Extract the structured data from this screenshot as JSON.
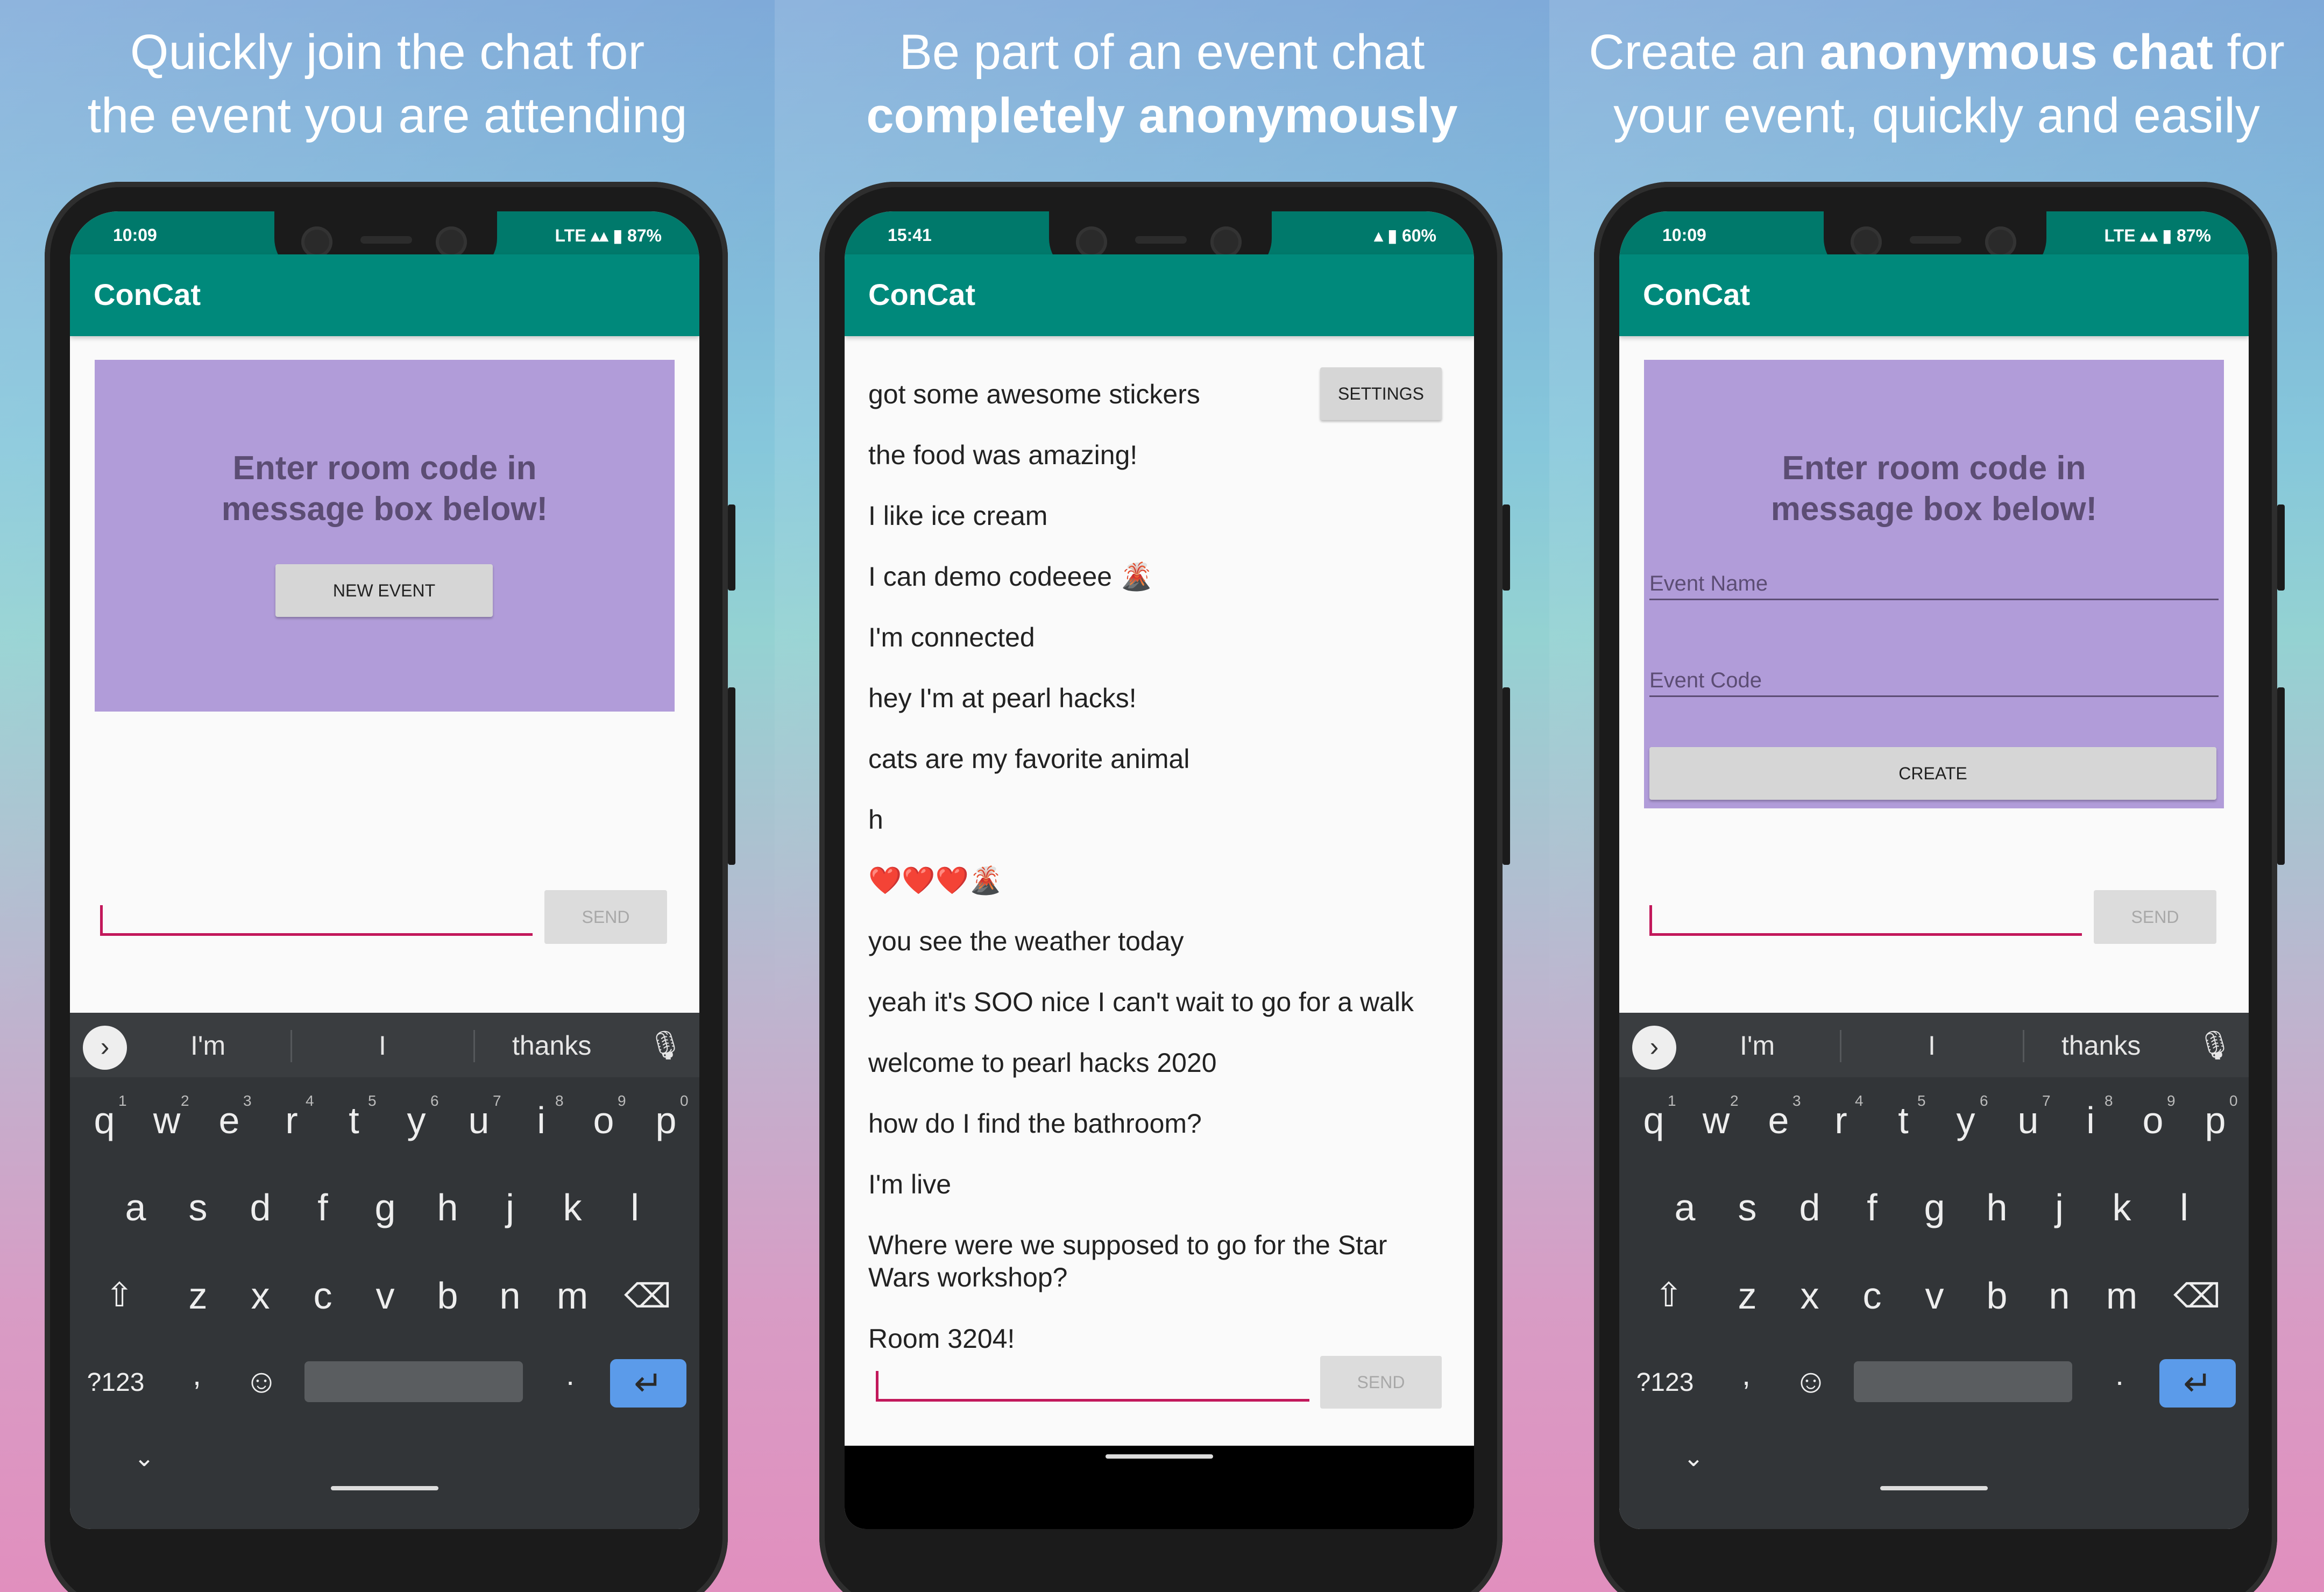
{
  "colors": {
    "appbar": "#00897b",
    "statusbar": "#00796b",
    "purple": "#b19cd9",
    "accent": "#c2185b",
    "enter": "#5b9bea"
  },
  "panel1": {
    "headline_line1": "Quickly join the chat for",
    "headline_line2": "the event you are attending",
    "status_time": "10:09",
    "status_right": "LTE ▴▴ ▮ 87%",
    "app_title": "ConCat",
    "room_line1": "Enter room code in",
    "room_line2": "message box below!",
    "new_event": "NEW EVENT",
    "send": "SEND",
    "suggestions": [
      "I'm",
      "I",
      "thanks"
    ]
  },
  "panel2": {
    "headline_line1": "Be part of an event chat",
    "headline_line2": "completely anonymously",
    "status_time": "15:41",
    "status_right": "▴ ▮ 60%",
    "app_title": "ConCat",
    "settings": "SETTINGS",
    "send": "SEND",
    "messages": [
      "got some awesome stickers",
      "the food was amazing!",
      "I like ice cream",
      "I can demo codeeee 🌋",
      "I'm connected",
      "hey I'm at pearl hacks!",
      "cats are my favorite animal",
      "h",
      "❤️❤️❤️🌋",
      "you see the weather today",
      "yeah it's SOO nice I can't wait to go for a walk",
      "welcome to pearl hacks 2020",
      "how do I find the bathroom?",
      "I'm live",
      "Where were we supposed to go for the Star",
      "Wars workshop?",
      "Room 3204!"
    ]
  },
  "panel3": {
    "headline_pre": "Create an ",
    "headline_bold": "anonymous chat",
    "headline_post": " for",
    "headline_line2": "your event, quickly and easily",
    "status_time": "10:09",
    "status_right": "LTE ▴▴ ▮ 87%",
    "app_title": "ConCat",
    "room_line1": "Enter room code in",
    "room_line2": "message box below!",
    "event_name_placeholder": "Event Name",
    "event_code_placeholder": "Event Code",
    "create": "CREATE",
    "send": "SEND",
    "suggestions": [
      "I'm",
      "I",
      "thanks"
    ]
  },
  "keyboard": {
    "row1": [
      "q",
      "w",
      "e",
      "r",
      "t",
      "y",
      "u",
      "i",
      "o",
      "p"
    ],
    "row1_sup": [
      "1",
      "2",
      "3",
      "4",
      "5",
      "6",
      "7",
      "8",
      "9",
      "0"
    ],
    "row2": [
      "a",
      "s",
      "d",
      "f",
      "g",
      "h",
      "j",
      "k",
      "l"
    ],
    "row3": [
      "z",
      "x",
      "c",
      "v",
      "b",
      "n",
      "m"
    ],
    "symbols": "?123",
    "comma": ",",
    "period": ".",
    "shift_icon": "⇧",
    "backspace_icon": "⌫",
    "emoji_icon": "☺",
    "enter_icon": "↵",
    "hide_icon": "⌄",
    "mic_icon": "🎙",
    "chevron_icon": "›"
  }
}
